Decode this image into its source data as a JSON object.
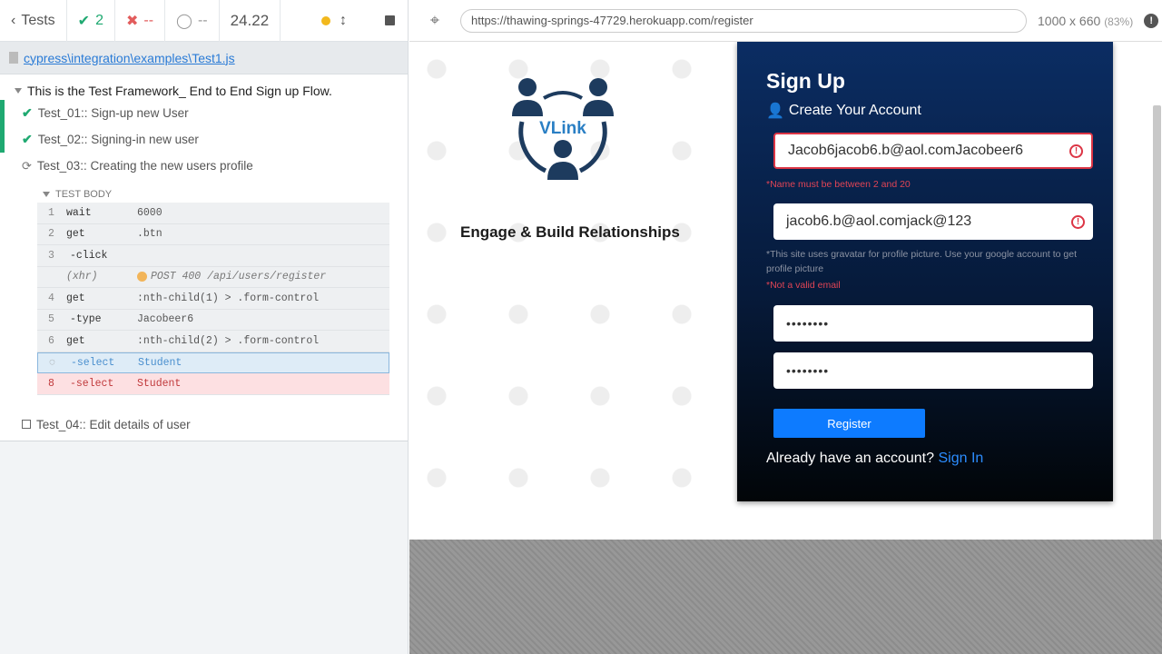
{
  "toolbar": {
    "tests_label": "Tests",
    "passed_count": "2",
    "failed_count": "--",
    "pending_count": "--",
    "duration": "24.22"
  },
  "spec_file": "cypress\\integration\\examples\\Test1.js",
  "suite_title": "This is the Test Framework_ End to End Sign up Flow.",
  "tests": [
    {
      "title": "Test_01:: Sign-up new User",
      "state": "passed"
    },
    {
      "title": "Test_02:: Signing-in new user",
      "state": "passed"
    },
    {
      "title": "Test_03:: Creating the new users profile",
      "state": "running"
    },
    {
      "title": "Test_04:: Edit details of user",
      "state": "pending"
    }
  ],
  "test_body_label": "TEST BODY",
  "commands": [
    {
      "num": "1",
      "name": "wait",
      "message": "6000",
      "kind": ""
    },
    {
      "num": "2",
      "name": "get",
      "message": ".btn",
      "kind": ""
    },
    {
      "num": "3",
      "name": "-click",
      "message": "",
      "kind": ""
    },
    {
      "num": "",
      "name": "(xhr)",
      "message": "POST 400 /api/users/register",
      "kind": "xhr"
    },
    {
      "num": "4",
      "name": "get",
      "message": ":nth-child(1) > .form-control",
      "kind": ""
    },
    {
      "num": "5",
      "name": "-type",
      "message": "Jacobeer6",
      "kind": ""
    },
    {
      "num": "6",
      "name": "get",
      "message": ":nth-child(2) > .form-control",
      "kind": ""
    },
    {
      "num": "",
      "name": "-select",
      "message": "Student",
      "kind": "active"
    },
    {
      "num": "8",
      "name": "-select",
      "message": "Student",
      "kind": "failed"
    }
  ],
  "browser": {
    "url": "https://thawing-springs-47729.herokuapp.com/register",
    "viewport": "1000 x 660",
    "scale": "(83%)"
  },
  "app": {
    "logo_text": "VLink",
    "tagline": "Engage & Build Relationships",
    "title": "Sign Up",
    "subtitle": "Create Your Account",
    "name_value": "Jacob6jacob6.b@aol.comJacobeer6",
    "name_error": "*Name must be between 2 and 20",
    "email_value": "jacob6.b@aol.comjack@123",
    "email_hint": "*This site uses gravatar for profile picture. Use your google account to get profile picture",
    "email_error": "*Not a valid email",
    "password_value": "••••••••",
    "password2_value": "••••••••",
    "register_label": "Register",
    "already_text": "Already have an account?",
    "signin_label": "Sign In",
    "accent_color": "#0d7bff",
    "error_color": "#dc3545"
  }
}
